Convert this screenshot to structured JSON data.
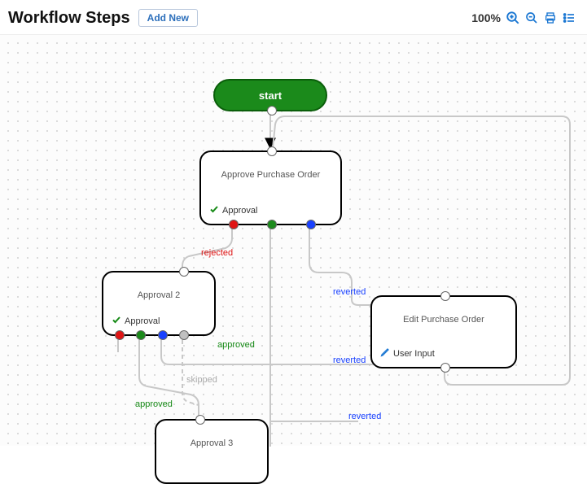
{
  "header": {
    "title": "Workflow Steps",
    "add_button": "Add New",
    "zoom_percent": "100%"
  },
  "nodes": {
    "start": {
      "label": "start"
    },
    "approve_po": {
      "title": "Approve Purchase Order",
      "action": "Approval"
    },
    "approval2": {
      "title": "Approval 2",
      "action": "Approval"
    },
    "approval3": {
      "title": "Approval 3"
    },
    "edit_po": {
      "title": "Edit Purchase Order",
      "action": "User Input"
    }
  },
  "edge_labels": {
    "rejected": "rejected",
    "approved1": "approved",
    "approved2": "approved",
    "skipped": "skipped",
    "reverted1": "reverted",
    "reverted2": "reverted",
    "reverted3": "reverted"
  },
  "chart_data": {
    "type": "diagram",
    "title": "Workflow Steps",
    "nodes": [
      {
        "id": "start",
        "label": "start",
        "kind": "start"
      },
      {
        "id": "approve_po",
        "label": "Approve Purchase Order",
        "action": "Approval"
      },
      {
        "id": "approval2",
        "label": "Approval 2",
        "action": "Approval"
      },
      {
        "id": "approval3",
        "label": "Approval 3"
      },
      {
        "id": "edit_po",
        "label": "Edit Purchase Order",
        "action": "User Input"
      }
    ],
    "edges": [
      {
        "from": "start",
        "to": "approve_po",
        "label": ""
      },
      {
        "from": "approve_po",
        "to": "approval2",
        "label": "rejected",
        "color": "red"
      },
      {
        "from": "approve_po",
        "to": "edit_po",
        "label": "reverted",
        "color": "blue"
      },
      {
        "from": "approval2",
        "to": "approval3",
        "label": "approved",
        "color": "green"
      },
      {
        "from": "approval2",
        "to": "approval3",
        "label": "skipped",
        "color": "grey"
      },
      {
        "from": "approval2",
        "to": "edit_po",
        "label": "reverted",
        "color": "blue"
      },
      {
        "from": "approval3",
        "to": "edit_po",
        "label": "reverted",
        "color": "blue"
      },
      {
        "from": "edit_po",
        "to": "approve_po",
        "label": ""
      }
    ]
  }
}
